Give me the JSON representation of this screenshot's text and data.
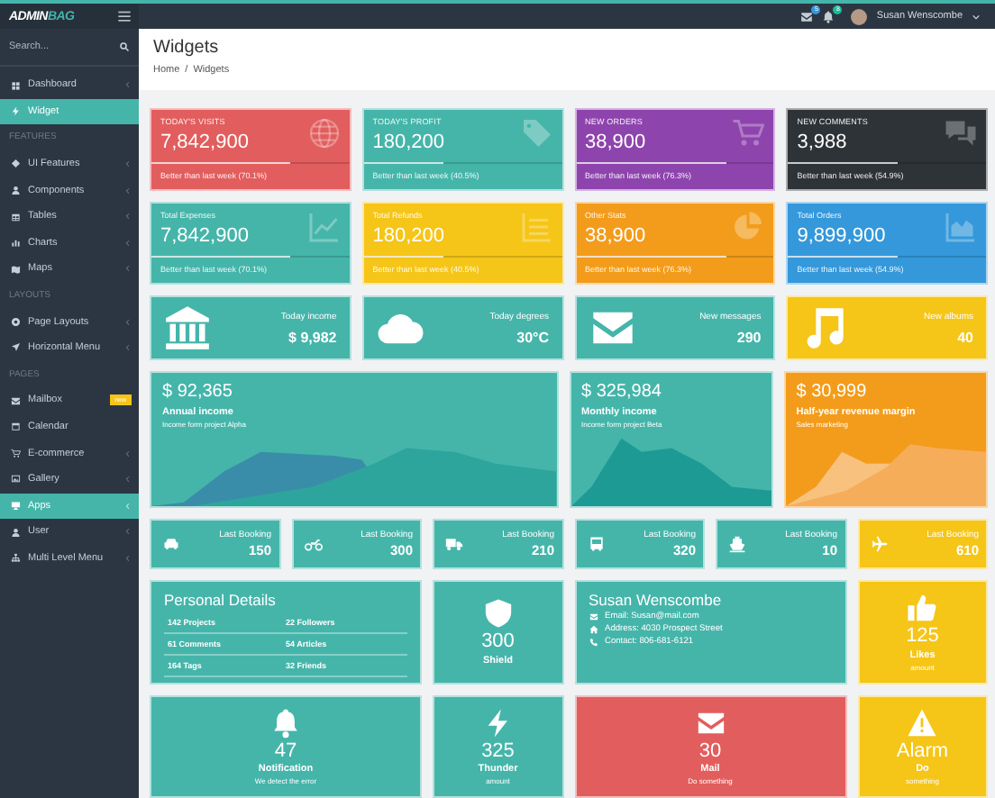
{
  "topbar": {
    "logo": {
      "first": "ADMIN",
      "second": "BAG"
    },
    "messages_badge": "5",
    "alerts_badge": "8",
    "user_name": "Susan Wenscombe"
  },
  "search": {
    "placeholder": "Search..."
  },
  "sidebar": {
    "items": [
      {
        "kind": "link",
        "label": "Dashboard",
        "selected": false,
        "submenu": true
      },
      {
        "kind": "link",
        "label": "Widget",
        "selected": true,
        "submenu": false
      },
      {
        "kind": "header",
        "label": "FEATURES"
      },
      {
        "kind": "link",
        "label": "UI Features",
        "selected": false,
        "submenu": true
      },
      {
        "kind": "link",
        "label": "Components",
        "selected": false,
        "submenu": true
      },
      {
        "kind": "link",
        "label": "Tables",
        "selected": false,
        "submenu": true
      },
      {
        "kind": "link",
        "label": "Charts",
        "selected": false,
        "submenu": true
      },
      {
        "kind": "link",
        "label": "Maps",
        "selected": false,
        "submenu": true
      },
      {
        "kind": "header",
        "label": "LAYOUTS"
      },
      {
        "kind": "link",
        "label": "Page Layouts",
        "selected": false,
        "submenu": true
      },
      {
        "kind": "link",
        "label": "Horizontal Menu",
        "selected": false,
        "submenu": true
      },
      {
        "kind": "header",
        "label": "PAGES"
      },
      {
        "kind": "link",
        "label": "Mailbox",
        "selected": false,
        "submenu": false,
        "badge": "new"
      },
      {
        "kind": "link",
        "label": "Calendar",
        "selected": false,
        "submenu": false
      },
      {
        "kind": "link",
        "label": "E-commerce",
        "selected": false,
        "submenu": true
      },
      {
        "kind": "link",
        "label": "Gallery",
        "selected": false,
        "submenu": true
      },
      {
        "kind": "link",
        "label": "Apps",
        "selected": true,
        "submenu": true
      },
      {
        "kind": "link",
        "label": "User",
        "selected": false,
        "submenu": true
      },
      {
        "kind": "link",
        "label": "Multi Level Menu",
        "selected": false,
        "submenu": true
      }
    ]
  },
  "page": {
    "title": "Widgets",
    "breadcrumb": {
      "items": [
        "Home",
        "Widgets"
      ],
      "separator": "/"
    }
  },
  "stats": [
    {
      "label": "TODAY'S VISITS",
      "value": "7,842,900",
      "note": "Better than last week (70.1%)",
      "level": 0.7,
      "color": "#e25d5d"
    },
    {
      "label": "TODAY'S PROFIT",
      "value": "180,200",
      "note": "Better than last week (40.5%)",
      "level": 0.4,
      "color": "#45b5aa"
    },
    {
      "label": "NEW ORDERS",
      "value": "38,900",
      "note": "Better than last week (76.3%)",
      "level": 0.76,
      "color": "#8e44ad"
    },
    {
      "label": "NEW COMMENTS",
      "value": "3,988",
      "note": "Better than last week (54.9%)",
      "level": 0.55,
      "color": "#2e3337"
    },
    {
      "label": "Total Expenses",
      "value": "7,842,900",
      "note": "Better than last week (70.1%)",
      "level": 0.7,
      "color": "#45b5aa"
    },
    {
      "label": "Total Refunds",
      "value": "180,200",
      "note": "Better than last week (40.5%)",
      "level": 0.4,
      "color": "#f5c518"
    },
    {
      "label": "Other Stats",
      "value": "38,900",
      "note": "Better than last week (76.3%)",
      "level": 0.76,
      "color": "#f39c1b"
    },
    {
      "label": "Total Orders",
      "value": "9,899,900",
      "note": "Better than last week (54.9%)",
      "level": 0.55,
      "color": "#3498db"
    }
  ],
  "info_cards": [
    {
      "label": "Today income",
      "value": "$ 9,982",
      "color": "#45b5aa"
    },
    {
      "label": "Today degrees",
      "value": "30°C",
      "color": "#45b5aa"
    },
    {
      "label": "New messages",
      "value": "290",
      "color": "#45b5aa"
    },
    {
      "label": "New albums",
      "value": "40",
      "color": "#f5c518"
    }
  ],
  "income_cards": [
    {
      "value": "$ 92,365",
      "title": "Annual income",
      "subtitle": "Income form project Alpha",
      "color": "#45b5aa"
    },
    {
      "value": "$ 325,984",
      "title": "Monthly income",
      "subtitle": "Income form project Beta",
      "color": "#45b5aa"
    },
    {
      "value": "$ 30,999",
      "title": "Half-year revenue margin",
      "subtitle": "Sales marketing",
      "color": "#f39c1b"
    }
  ],
  "bookings": [
    {
      "label": "Last Booking",
      "value": "150",
      "color": "#45b5aa"
    },
    {
      "label": "Last Booking",
      "value": "300",
      "color": "#45b5aa"
    },
    {
      "label": "Last Booking",
      "value": "210",
      "color": "#45b5aa"
    },
    {
      "label": "Last Booking",
      "value": "320",
      "color": "#45b5aa"
    },
    {
      "label": "Last Booking",
      "value": "10",
      "color": "#45b5aa"
    },
    {
      "label": "Last Booking",
      "value": "610",
      "color": "#f5c518"
    }
  ],
  "personal": {
    "title": "Personal Details",
    "rows": [
      [
        "142 Projects",
        "22 Followers"
      ],
      [
        "61 Comments",
        "54 Articles"
      ],
      [
        "164 Tags",
        "32 Friends"
      ]
    ]
  },
  "contact": {
    "name": "Susan Wenscombe",
    "lines": [
      {
        "kind": "email",
        "text": "Email: Susan@mail.com"
      },
      {
        "kind": "address",
        "text": "Address: 4030 Prospect Street"
      },
      {
        "kind": "phone",
        "text": "Contact: 806-681-6121"
      }
    ]
  },
  "tiles": [
    {
      "value": "300",
      "label": "Shield",
      "color": "#45b5aa"
    },
    {
      "value": "125",
      "label": "Likes",
      "sub": "amount",
      "color": "#f5c518"
    },
    {
      "value": "47",
      "label": "Notification",
      "sub": "We detect the error",
      "color": "#45b5aa"
    },
    {
      "value": "325",
      "label": "Thunder",
      "sub": "amount",
      "color": "#45b5aa"
    },
    {
      "value": "30",
      "label": "Mail",
      "sub": "Do something",
      "color": "#e25d5d"
    },
    {
      "value": "Alarm",
      "label": "Do",
      "sub": "something",
      "color": "#f5c518"
    }
  ]
}
